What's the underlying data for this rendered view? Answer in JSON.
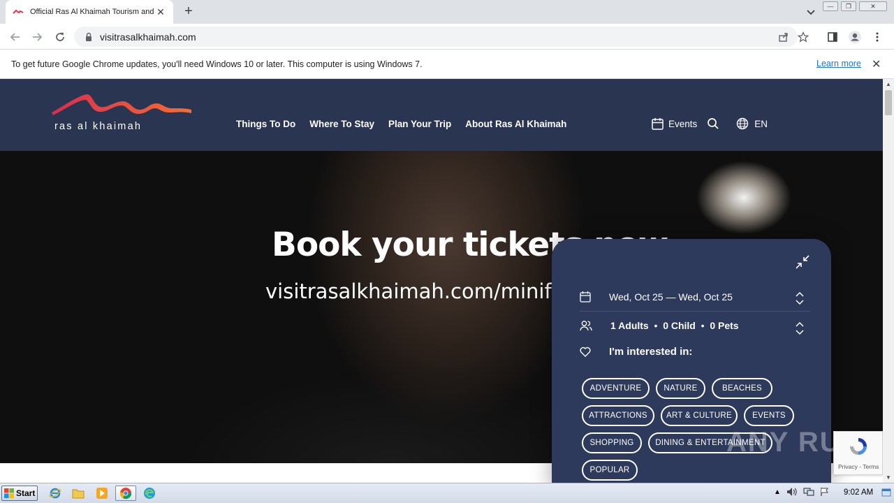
{
  "browser": {
    "tab_title": "Official Ras Al Khaimah Tourism and V",
    "url": "visitrasalkhaimah.com",
    "infobar_message": "To get future Google Chrome updates, you'll need Windows 10 or later. This computer is using Windows 7.",
    "infobar_link": "Learn more"
  },
  "site": {
    "logo_text": "ras al khaimah",
    "nav": [
      "Things To Do",
      "Where To Stay",
      "Plan Your Trip",
      "About Ras Al Khaimah"
    ],
    "events_label": "Events",
    "language": "EN"
  },
  "hero": {
    "title": "Book your tickets now",
    "subtitle": "visitrasalkhaimah.com/minifoo"
  },
  "widget": {
    "dates": "Wed, Oct 25 — Wed, Oct 25",
    "adults": "1 Adults",
    "child": "0 Child",
    "pets": "0 Pets",
    "separator": "•",
    "interest_title": "I'm interested in:",
    "tags": [
      "ADVENTURE",
      "NATURE",
      "BEACHES",
      "ATTRACTIONS",
      "ART & CULTURE",
      "EVENTS",
      "SHOPPING",
      "DINING & ENTERTAINMENT",
      "POPULAR"
    ]
  },
  "recaptcha": {
    "footer": "Privacy - Terms"
  },
  "watermark": "ANY RUN",
  "taskbar": {
    "start_label": "Start",
    "clock": "9:02 AM"
  },
  "colors": {
    "header_navy": "#2a3552",
    "widget_navy": "#2d3a5b",
    "logo_red": "#e0364a",
    "logo_orange": "#f26b36",
    "link_blue": "#1a73e8"
  }
}
